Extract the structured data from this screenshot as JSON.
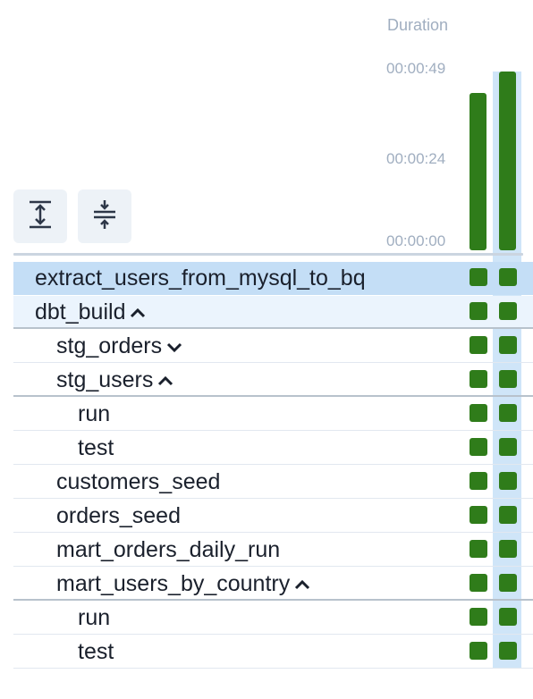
{
  "header": {
    "duration_title": "Duration"
  },
  "y_axis": {
    "ticks": [
      "00:00:49",
      "00:00:24",
      "00:00:00"
    ]
  },
  "toolbar": {
    "expand_icon": "expand-all-icon",
    "collapse_icon": "collapse-all-icon"
  },
  "colors": {
    "success": "#2f7c1a",
    "selected_row": "#c4def6",
    "hover_row": "#ebf4fd",
    "selected_column": "#cfe5f8"
  },
  "chart_data": {
    "type": "bar",
    "ylabel": "Duration",
    "ylim": [
      "00:00:00",
      "00:00:49"
    ],
    "series": [
      {
        "values_seconds": [
          43,
          49
        ]
      }
    ]
  },
  "tree": [
    {
      "label": "extract_users_from_mysql_to_bq",
      "state": "success",
      "selected": true
    },
    {
      "label": "dbt_build",
      "chevron": "up",
      "state": "success"
    },
    {
      "label": "stg_orders",
      "chevron": "down",
      "state": "success"
    },
    {
      "label": "stg_users",
      "chevron": "up",
      "state": "success"
    },
    {
      "label": "run",
      "state": "success"
    },
    {
      "label": "test",
      "state": "success"
    },
    {
      "label": "customers_seed",
      "state": "success"
    },
    {
      "label": "orders_seed",
      "state": "success"
    },
    {
      "label": "mart_orders_daily_run",
      "state": "success"
    },
    {
      "label": "mart_users_by_country",
      "chevron": "up",
      "state": "success"
    },
    {
      "label": "run",
      "state": "success"
    },
    {
      "label": "test",
      "state": "success"
    }
  ]
}
